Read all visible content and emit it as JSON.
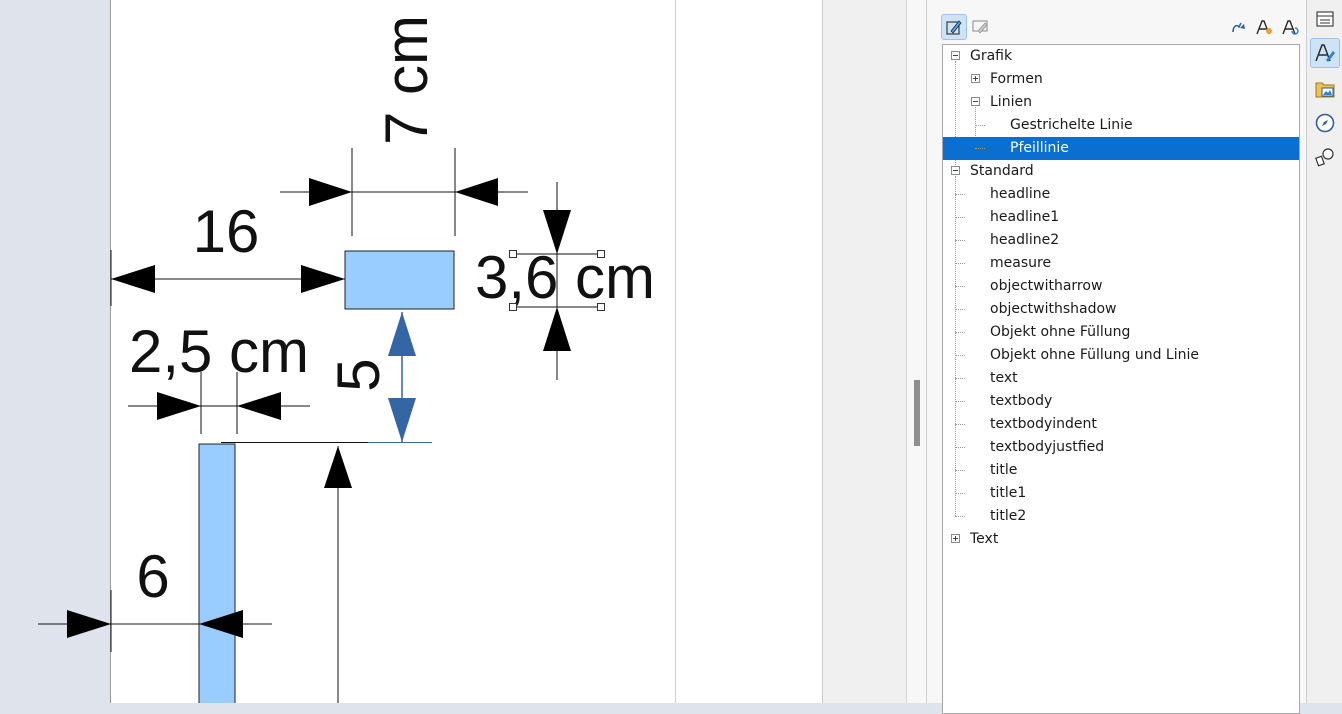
{
  "drawing": {
    "dimension_labels": {
      "top_length": "7 cm",
      "left_length": "16",
      "box_height": "3,6 cm",
      "small_width": "2,5 cm",
      "gap_vertical": "5",
      "bottom_offset": "6"
    },
    "colors": {
      "shape_fill": "#99ccff",
      "selected_arrow": "#3465a4"
    }
  },
  "sidebar": {
    "styles_toolbar": {
      "buttons": [
        {
          "name": "drawing-styles-icon",
          "active": true
        },
        {
          "name": "presentation-styles-icon",
          "active": false
        },
        {
          "name": "fill-format-mode-icon",
          "active": false
        },
        {
          "name": "new-style-from-selection-icon",
          "active": false
        },
        {
          "name": "update-style-icon",
          "active": false
        }
      ]
    },
    "tree": [
      {
        "label": "Grafik",
        "level": 0,
        "expander": "minus",
        "selected": false
      },
      {
        "label": "Formen",
        "level": 1,
        "expander": "plus",
        "selected": false
      },
      {
        "label": "Linien",
        "level": 1,
        "expander": "minus",
        "selected": false
      },
      {
        "label": "Gestrichelte Linie",
        "level": 2,
        "expander": null,
        "selected": false
      },
      {
        "label": "Pfeillinie",
        "level": 2,
        "expander": null,
        "selected": true
      },
      {
        "label": "Standard",
        "level": 0,
        "expander": "minus",
        "selected": false
      },
      {
        "label": "headline",
        "level": 1,
        "expander": null,
        "selected": false
      },
      {
        "label": "headline1",
        "level": 1,
        "expander": null,
        "selected": false
      },
      {
        "label": "headline2",
        "level": 1,
        "expander": null,
        "selected": false
      },
      {
        "label": "measure",
        "level": 1,
        "expander": null,
        "selected": false
      },
      {
        "label": "objectwitharrow",
        "level": 1,
        "expander": null,
        "selected": false
      },
      {
        "label": "objectwithshadow",
        "level": 1,
        "expander": null,
        "selected": false
      },
      {
        "label": "Objekt ohne Füllung",
        "level": 1,
        "expander": null,
        "selected": false
      },
      {
        "label": "Objekt ohne Füllung und Linie",
        "level": 1,
        "expander": null,
        "selected": false
      },
      {
        "label": "text",
        "level": 1,
        "expander": null,
        "selected": false
      },
      {
        "label": "textbody",
        "level": 1,
        "expander": null,
        "selected": false
      },
      {
        "label": "textbodyindent",
        "level": 1,
        "expander": null,
        "selected": false
      },
      {
        "label": "textbodyjustfied",
        "level": 1,
        "expander": null,
        "selected": false
      },
      {
        "label": "title",
        "level": 1,
        "expander": null,
        "selected": false
      },
      {
        "label": "title1",
        "level": 1,
        "expander": null,
        "selected": false
      },
      {
        "label": "title2",
        "level": 1,
        "expander": null,
        "selected": false
      },
      {
        "label": "Text",
        "level": 0,
        "expander": "plus",
        "selected": false
      }
    ],
    "selection_color": "#0a6fd0"
  },
  "deck": {
    "buttons": [
      {
        "name": "properties-icon",
        "active": false
      },
      {
        "name": "styles-icon",
        "active": true
      },
      {
        "name": "gallery-icon",
        "active": false
      },
      {
        "name": "navigator-icon",
        "active": false
      },
      {
        "name": "shapes-icon",
        "active": false
      }
    ]
  }
}
